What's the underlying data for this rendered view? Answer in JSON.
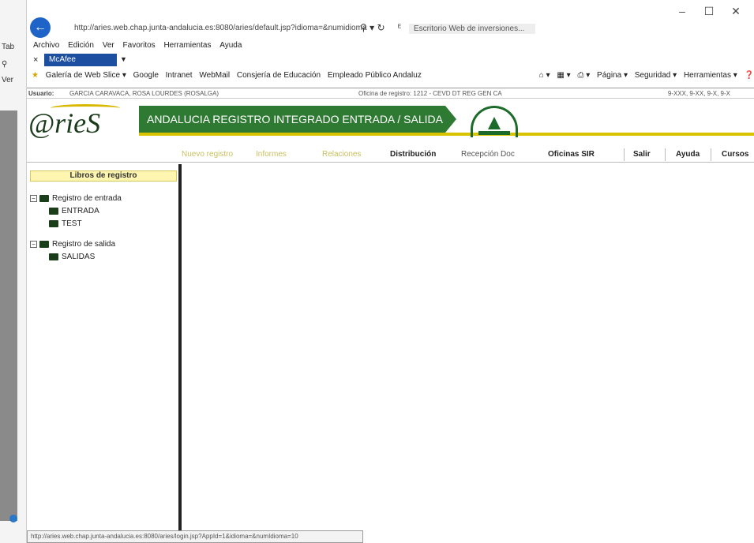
{
  "left_window": {
    "labels": [
      "Tab",
      "Ver"
    ]
  },
  "browser": {
    "url": "http://aries.web.chap.junta-andalucia.es:8080/aries/default.jsp?idioma=&numidioma",
    "tab_title": "Escritorio Web de inversiones...",
    "menu": [
      "Archivo",
      "Edición",
      "Ver",
      "Favoritos",
      "Herramientas",
      "Ayuda"
    ],
    "mcafee": "McAfee",
    "favorites": [
      "Galería de Web Slice ▾",
      "Google",
      "Intranet",
      "WebMail",
      "Consjería de Educación",
      "Empleado Público Andaluz"
    ],
    "tools": [
      "Página ▾",
      "Seguridad ▾",
      "Herramientas ▾"
    ],
    "status_url": "http://aries.web.chap.junta-andalucia.es:8080/aries/login.jsp?AppId=1&idioma=&numIdioma=10"
  },
  "user_bar": {
    "label": "Usuario:",
    "user": "GARCIA CARAVACA, ROSA LOURDES (ROSALGA)",
    "office": "Oficina de registro: 1212 - CEVD DT REG GEN CA",
    "date": "9-XXX, 9-XX, 9-X, 9-X"
  },
  "header": {
    "logo": "@rieS",
    "title": "ANDALUCIA REGISTRO INTEGRADO ENTRADA / SALIDA"
  },
  "nav": {
    "items": [
      "Nuevo registro",
      "Informes",
      "Relaciones",
      "Distribución",
      "Recepción Doc",
      "Oficinas SIR",
      "Salir",
      "Ayuda",
      "Cursos"
    ]
  },
  "sidebar": {
    "title": "Libros de registro",
    "entrada_label": "Registro de entrada",
    "entrada_children": [
      "ENTRADA",
      "TEST"
    ],
    "salida_label": "Registro de salida",
    "salida_children": [
      "SALIDAS"
    ]
  }
}
